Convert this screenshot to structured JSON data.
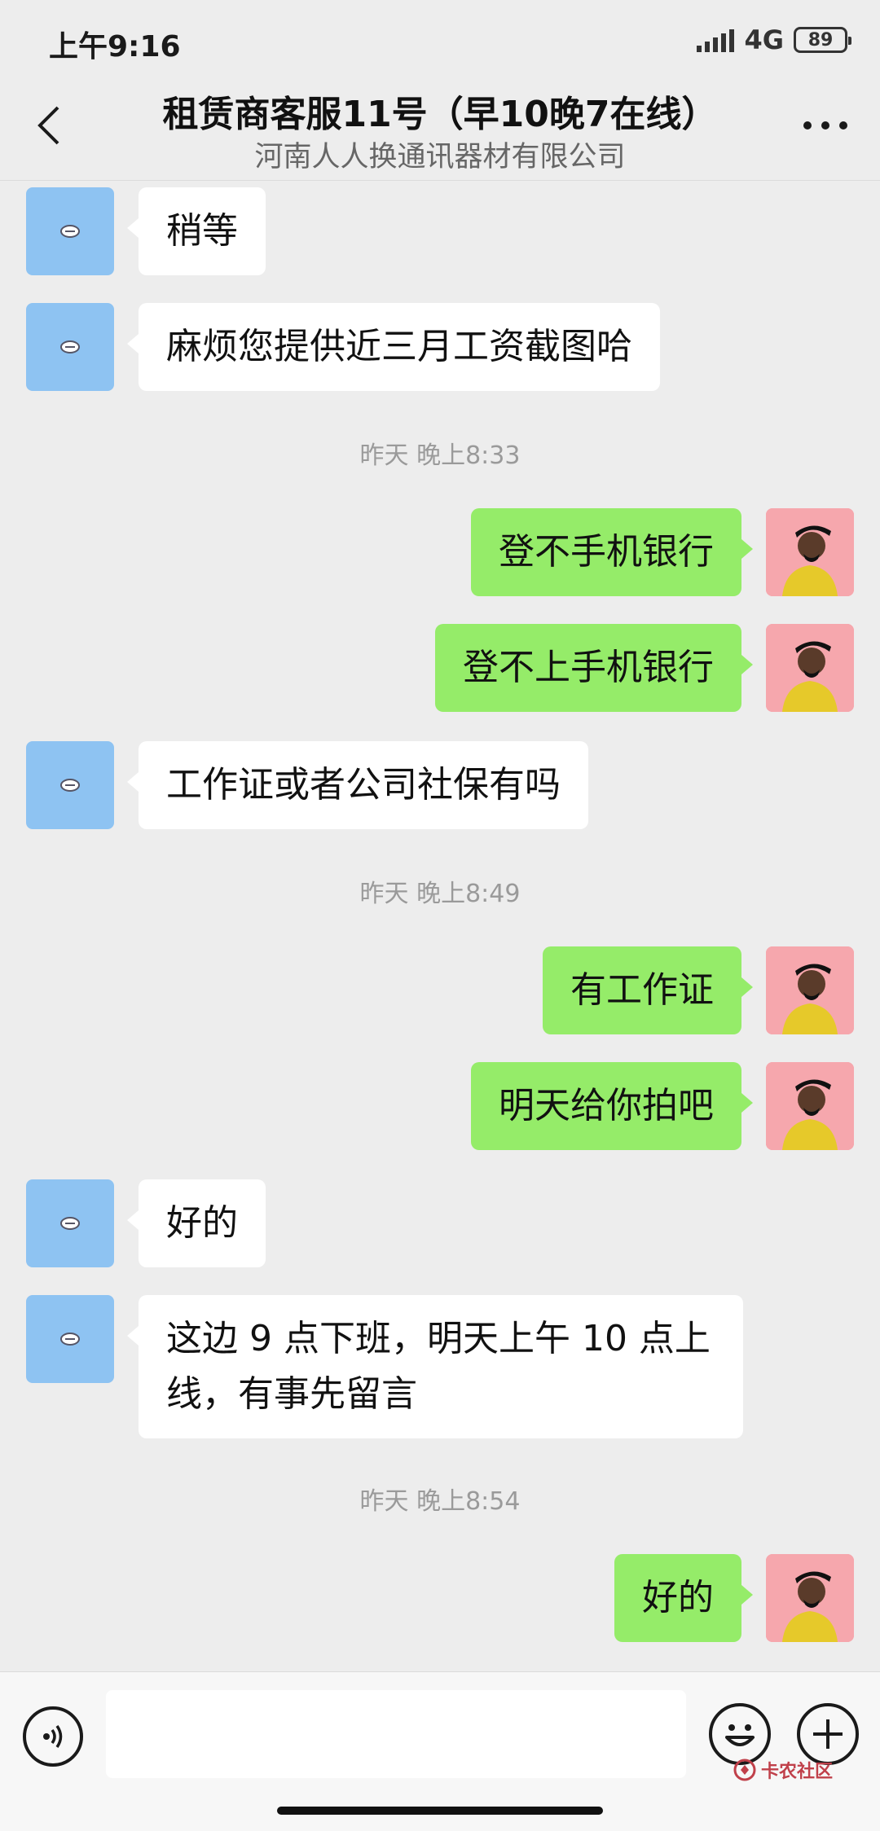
{
  "status_bar": {
    "time": "上午9:16",
    "network": "4G",
    "battery": "89"
  },
  "header": {
    "title": "租赁商客服11号（早10晚7在线）",
    "subtitle": "河南人人换通讯器材有限公司"
  },
  "messages": [
    {
      "type": "in",
      "text": "稍等"
    },
    {
      "type": "in",
      "text": "麻烦您提供近三月工资截图哈"
    },
    {
      "type": "time",
      "text": "昨天 晚上8:33"
    },
    {
      "type": "out",
      "text": "登不手机银行"
    },
    {
      "type": "out",
      "text": "登不上手机银行"
    },
    {
      "type": "in",
      "text": "工作证或者公司社保有吗"
    },
    {
      "type": "time",
      "text": "昨天 晚上8:49"
    },
    {
      "type": "out",
      "text": "有工作证"
    },
    {
      "type": "out",
      "text": "明天给你拍吧"
    },
    {
      "type": "in",
      "text": "好的"
    },
    {
      "type": "in",
      "text": "这边 9 点下班，明天上午 10 点上线，有事先留言"
    },
    {
      "type": "time",
      "text": "昨天 晚上8:54"
    },
    {
      "type": "out",
      "text": "好的"
    }
  ],
  "watermark": {
    "text": "卡农社区"
  },
  "colors": {
    "background": "#ededed",
    "outgoing_bubble": "#95ec69",
    "incoming_bubble": "#ffffff",
    "agent_avatar": "#8ec3f2",
    "user_avatar": "#f6a7ad"
  },
  "icons": {
    "back": "chevron-left-icon",
    "more": "more-dots-icon",
    "voice": "voice-icon",
    "emoji": "emoji-icon",
    "plus": "plus-icon"
  }
}
